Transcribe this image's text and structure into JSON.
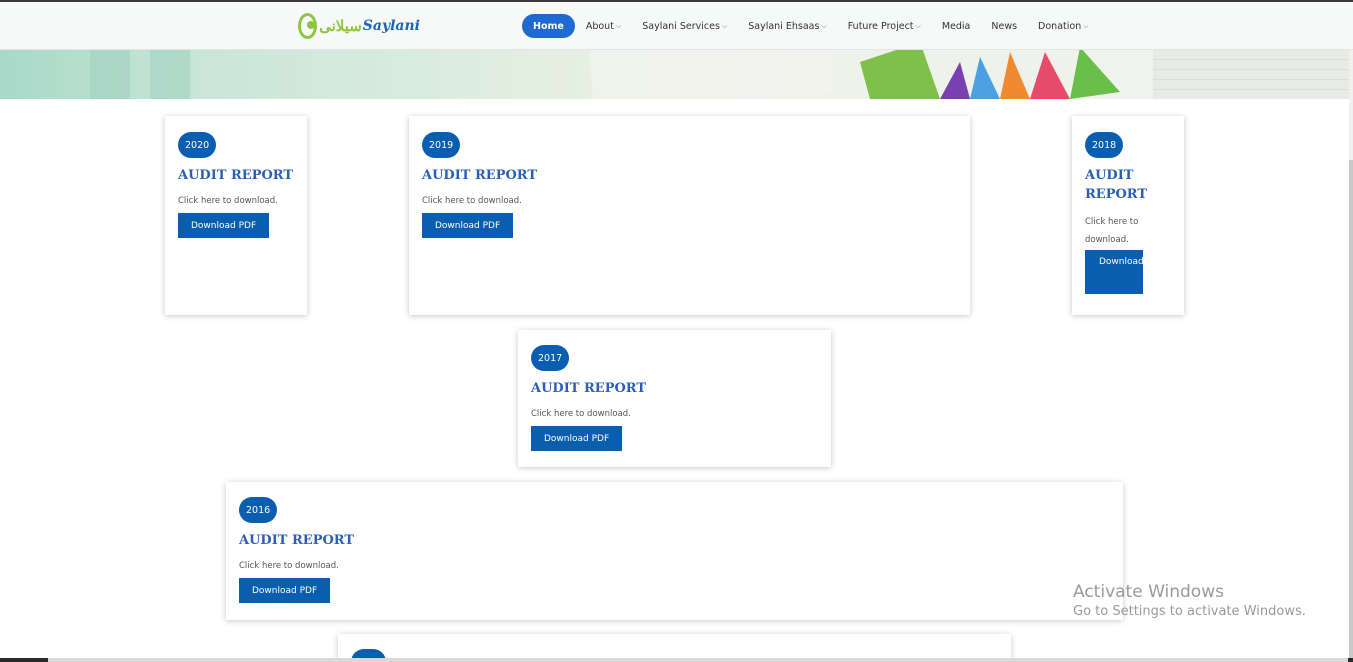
{
  "brand": {
    "logo_urdu": "سیلانی",
    "logo_text": "Saylani"
  },
  "nav": {
    "items": [
      {
        "label": "Home",
        "has_dropdown": false,
        "active": true
      },
      {
        "label": "About",
        "has_dropdown": true
      },
      {
        "label": "Saylani Services",
        "has_dropdown": true
      },
      {
        "label": "Saylani Ehsaas",
        "has_dropdown": true
      },
      {
        "label": "Future Project",
        "has_dropdown": true
      },
      {
        "label": "Media",
        "has_dropdown": false
      },
      {
        "label": "News",
        "has_dropdown": false
      },
      {
        "label": "Donation",
        "has_dropdown": true
      }
    ]
  },
  "reports": [
    {
      "year": "2020",
      "title": "AUDIT REPORT",
      "desc": "Click here to download.",
      "button": "Download PDF"
    },
    {
      "year": "2019",
      "title": "AUDIT REPORT",
      "desc": "Click here to download.",
      "button": "Download PDF"
    },
    {
      "year": "2018",
      "title": "AUDIT REPORT",
      "desc": "Click here to download.",
      "button": "Download PDF"
    },
    {
      "year": "2017",
      "title": "AUDIT REPORT",
      "desc": "Click here to download.",
      "button": "Download PDF"
    },
    {
      "year": "2016",
      "title": "AUDIT REPORT",
      "desc": "Click here to download.",
      "button": "Download PDF"
    }
  ],
  "watermark": {
    "line1": "Activate Windows",
    "line2": "Go to Settings to activate Windows."
  },
  "colors": {
    "primary": "#0a5eb0",
    "title": "#2b5fb4",
    "brand_green": "#8dc63f"
  }
}
